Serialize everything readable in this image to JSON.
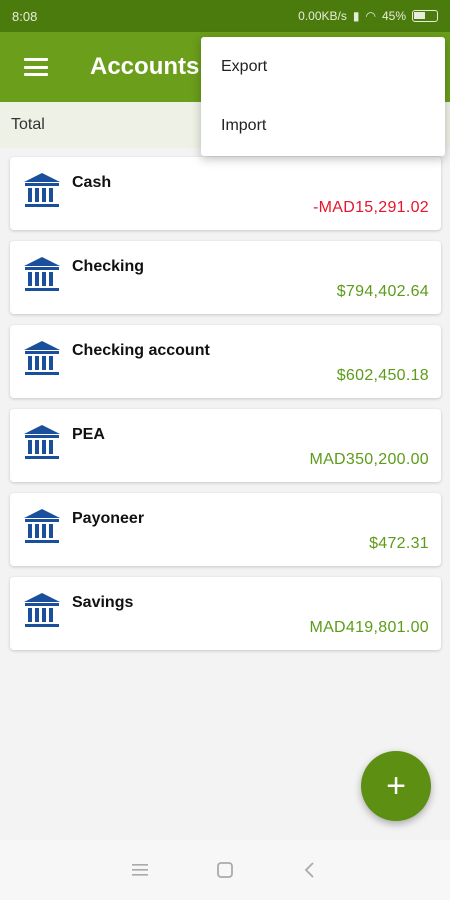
{
  "status_bar": {
    "time": "8:08",
    "net_speed": "0.00KB/s",
    "battery": "45%"
  },
  "app_bar": {
    "title": "Accounts"
  },
  "total_label": "Total",
  "menu": {
    "items": [
      {
        "label": "Export"
      },
      {
        "label": "Import"
      }
    ]
  },
  "accounts": [
    {
      "name": "Cash",
      "balance": "-MAD15,291.02",
      "negative": true
    },
    {
      "name": "Checking",
      "balance": "$794,402.64"
    },
    {
      "name": "Checking account",
      "balance": "$602,450.18"
    },
    {
      "name": "PEA",
      "balance": "MAD350,200.00"
    },
    {
      "name": "Payoneer",
      "balance": "$472.31"
    },
    {
      "name": "Savings",
      "balance": "MAD419,801.00"
    }
  ],
  "fab": {
    "icon": "plus-icon",
    "label": "+"
  },
  "colors": {
    "app_bar": "#6a9e1b",
    "status_bar": "#4b7a0d",
    "positive": "#5c9c1a",
    "negative": "#e8142c",
    "icon_blue": "#1a4f9c"
  }
}
